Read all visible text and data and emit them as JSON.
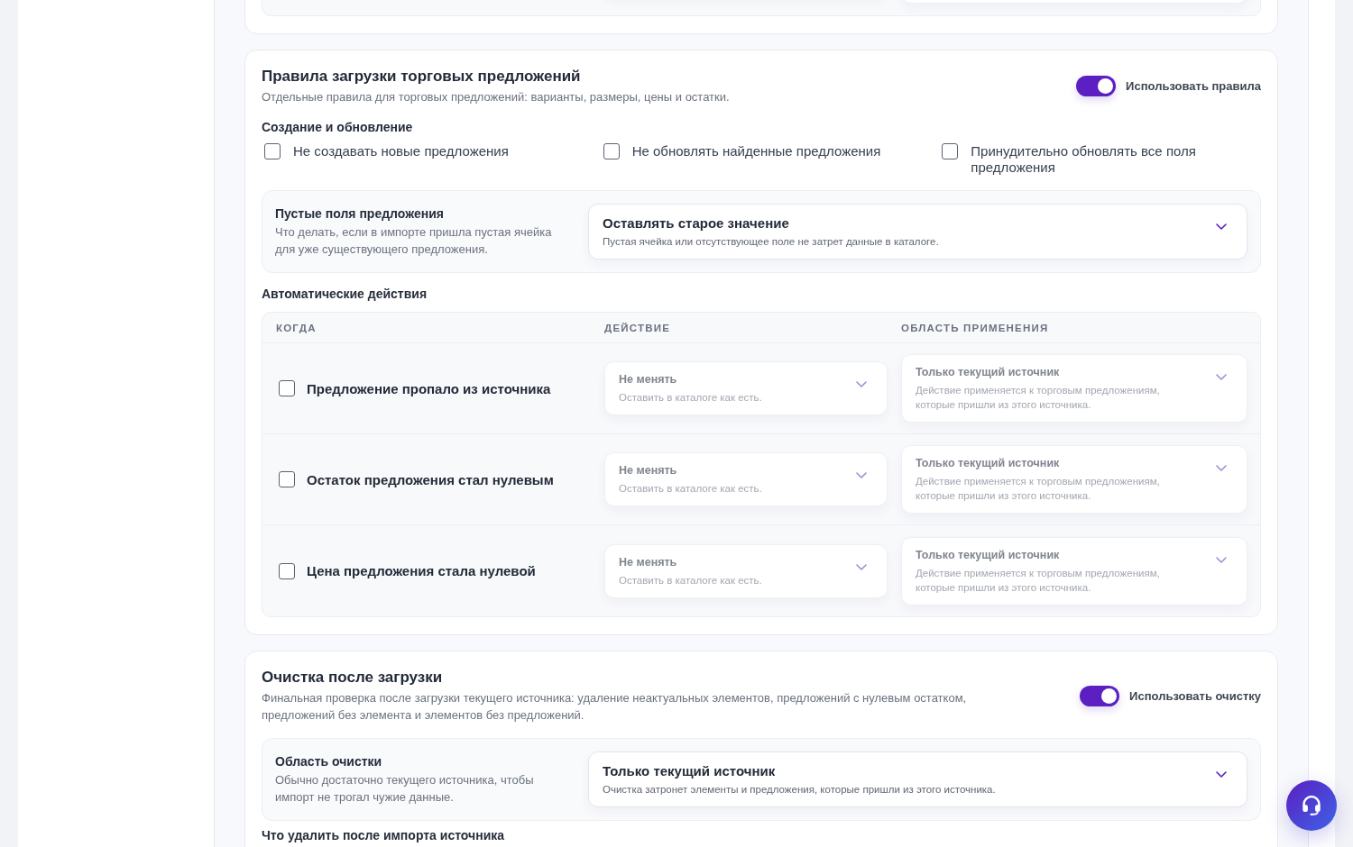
{
  "offer_rules": {
    "title": "Правила загрузки торговых предложений",
    "description": "Отдельные правила для торговых предложений: варианты, размеры, цены и остатки.",
    "toggle": {
      "label": "Использовать правила",
      "on": true
    },
    "create_update": {
      "heading": "Создание и обновление",
      "options": [
        {
          "label": "Не создавать новые предложения",
          "checked": false
        },
        {
          "label": "Не обновлять найденные предложения",
          "checked": false
        },
        {
          "label": "Принудительно обновлять все поля предложения",
          "checked": false
        }
      ]
    },
    "empty_fields": {
      "title": "Пустые поля предложения",
      "description": "Что делать, если в импорте пришла пустая ячейка для уже существующего предложения.",
      "select": {
        "value": "Оставлять старое значение",
        "hint": "Пустая ячейка или отсутствующее поле не затрет данные в каталоге."
      }
    },
    "auto_actions": {
      "heading": "Автоматические действия",
      "columns": [
        "КОГДА",
        "ДЕЙСТВИЕ",
        "ОБЛАСТЬ ПРИМЕНЕНИЯ"
      ],
      "rows": [
        {
          "label": "Предложение пропало из источника",
          "checked": false,
          "action": {
            "value": "Не менять",
            "hint": "Оставить в каталоге как есть.",
            "disabled": true
          },
          "scope": {
            "value": "Только текущий источник",
            "hint": "Действие применяется к торговым предложениям, которые пришли из этого источника.",
            "disabled": true
          }
        },
        {
          "label": "Остаток предложения стал нулевым",
          "checked": false,
          "action": {
            "value": "Не менять",
            "hint": "Оставить в каталоге как есть.",
            "disabled": true
          },
          "scope": {
            "value": "Только текущий источник",
            "hint": "Действие применяется к торговым предложениям, которые пришли из этого источника.",
            "disabled": true
          }
        },
        {
          "label": "Цена предложения стала нулевой",
          "checked": false,
          "action": {
            "value": "Не менять",
            "hint": "Оставить в каталоге как есть.",
            "disabled": true
          },
          "scope": {
            "value": "Только текущий источник",
            "hint": "Действие применяется к торговым предложениям, которые пришли из этого источника.",
            "disabled": true
          }
        }
      ]
    }
  },
  "cleanup": {
    "title": "Очистка после загрузки",
    "description": "Финальная проверка после загрузки текущего источника: удаление неактуальных элементов, предложений с нулевым остатком, предложений без элемента и элементов без предложений.",
    "toggle": {
      "label": "Использовать очистку",
      "on": true
    },
    "scope_setting": {
      "title": "Область очистки",
      "description": "Обычно достаточно текущего источника, чтобы импорт не трогал чужие данные.",
      "select": {
        "value": "Только текущий источник",
        "hint": "Очистка затронет элементы и предложения, которые пришли из этого источника."
      }
    },
    "next_heading": "Что удалить после импорта источника"
  }
}
